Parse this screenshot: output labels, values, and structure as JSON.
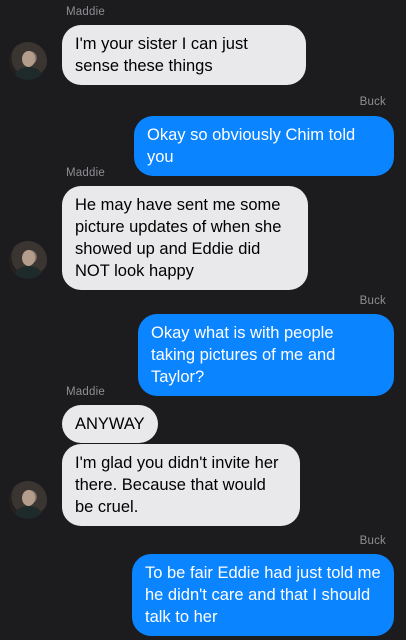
{
  "conversation": {
    "labels": {
      "maddie_1": "Maddie",
      "buck_1": "Buck",
      "maddie_2": "Maddie",
      "buck_2": "Buck",
      "maddie_3": "Maddie",
      "buck_3": "Buck"
    },
    "messages": {
      "m1": "I'm your sister I can just sense these things",
      "b1": "Okay so obviously Chim told you",
      "m2": "He may have sent me some picture updates of when she showed up and Eddie did NOT look happy",
      "b2": "Okay what is with people taking pictures of me and Taylor?",
      "m3a": "ANYWAY",
      "m3b": "I'm glad you didn't invite her there. Because that would be cruel.",
      "b3": "To be fair Eddie had just told me he didn't care and that I should talk to her"
    },
    "colors": {
      "background": "#1c1c1e",
      "incoming_bubble": "#e9e9eb",
      "outgoing_bubble": "#0a84ff",
      "sender_label": "#8e8e93"
    }
  }
}
